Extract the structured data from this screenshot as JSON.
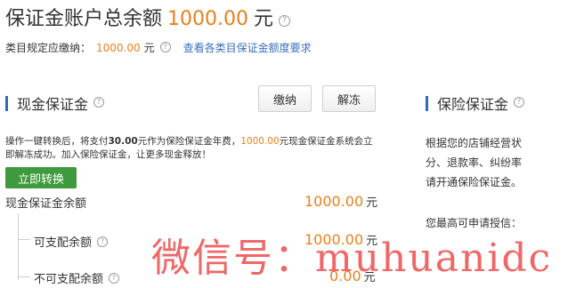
{
  "header": {
    "title": "保证金账户总余额",
    "amount": "1000.00",
    "unit": "元",
    "help_icon": "question-circle-icon"
  },
  "category": {
    "label": "类目规定应缴纳：",
    "amount": "1000.00",
    "unit": "元",
    "link": "查看各类目保证金额度要求"
  },
  "cash_section": {
    "title": "现金保证金",
    "pay_label": "缴纳",
    "unfreeze_label": "解冻",
    "desc_part1": "操作一键转换后，将支付",
    "desc_fee": "30.00",
    "desc_part2": "元作为保险保证金年费，",
    "desc_amount": "1000.00",
    "desc_part3": "元现金保证金系统会立即解冻成功。加入保险保证金，让更多现金释放！",
    "convert_label": "立即转换",
    "balance_label": "现金保证金余额",
    "balance_value": "1000.00",
    "available_label": "可支配余额",
    "available_value": "1000.00",
    "unavailable_label": "不可支配余额",
    "unavailable_value": "0.00",
    "unit": "元"
  },
  "insurance_section": {
    "title": "保险保证金",
    "line1": "根据您的店铺经营状",
    "line2": "分、退款率、纠纷率",
    "line3": "请开通保险保证金。",
    "limit_label": "您最高可申请授信："
  },
  "watermark": "微信号：muhuanidc",
  "colors": {
    "accent_orange": "#e8801a",
    "link_blue": "#3a6fbf",
    "section_bar": "#2e6bbd",
    "convert_green": "#3f9a3d",
    "watermark_red": "#ec4646"
  }
}
